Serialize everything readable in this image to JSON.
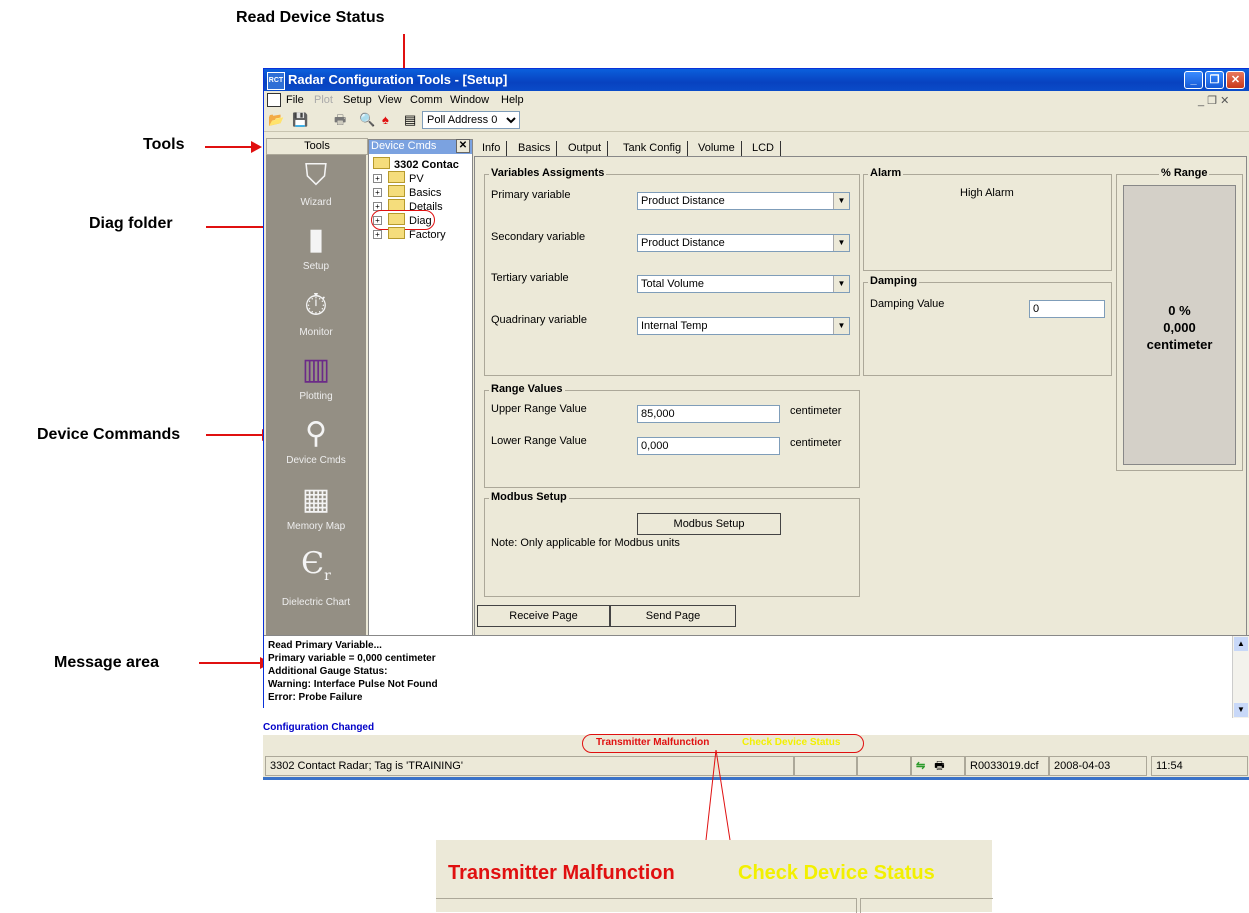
{
  "callouts": {
    "read_status": "Read Device Status",
    "tools": "Tools",
    "diag": "Diag folder",
    "device_commands": "Device Commands",
    "message_area": "Message area"
  },
  "window": {
    "title": "Radar Configuration Tools - [Setup]",
    "app_icon": "RCT"
  },
  "menu": [
    "File",
    "Plot",
    "Setup",
    "View",
    "Comm",
    "Window",
    "Help"
  ],
  "toolbar": {
    "poll_address": "Poll Address 0"
  },
  "tools": {
    "header": "Tools",
    "items": [
      {
        "label": "Wizard",
        "icon": "wizard-icon"
      },
      {
        "label": "Setup",
        "icon": "setup-icon"
      },
      {
        "label": "Monitor",
        "icon": "monitor-icon"
      },
      {
        "label": "Plotting",
        "icon": "plotting-icon"
      },
      {
        "label": "Device Cmds",
        "icon": "device-cmds-icon"
      },
      {
        "label": "Memory Map",
        "icon": "memory-map-icon"
      },
      {
        "label": "Dielectric Chart",
        "icon": "dielectric-chart-icon"
      }
    ]
  },
  "tree": {
    "header": "Device Cmds",
    "root": "3302 Contac",
    "items": [
      "PV",
      "Basics",
      "Details",
      "Diag",
      "Factory"
    ]
  },
  "tabs": [
    "Info",
    "Basics",
    "Output",
    "Tank Config",
    "Volume",
    "LCD"
  ],
  "variables": {
    "title": "Variables Assigments",
    "primary_label": "Primary variable",
    "primary_value": "Product Distance",
    "secondary_label": "Secondary variable",
    "secondary_value": "Product Distance",
    "tertiary_label": "Tertiary variable",
    "tertiary_value": "Total Volume",
    "quadrinary_label": "Quadrinary variable",
    "quadrinary_value": "Internal Temp"
  },
  "alarm": {
    "title": "Alarm",
    "value": "High Alarm"
  },
  "damping": {
    "title": "Damping",
    "label": "Damping Value",
    "value": "0"
  },
  "range_pct": {
    "title": "% Range",
    "percent": "0 %",
    "value": "0,000",
    "unit": "centimeter"
  },
  "range_values": {
    "title": "Range Values",
    "upper_label": "Upper Range Value",
    "upper_value": "85,000",
    "upper_unit": "centimeter",
    "lower_label": "Lower Range Value",
    "lower_value": "0,000",
    "lower_unit": "centimeter"
  },
  "modbus": {
    "title": "Modbus Setup",
    "button": "Modbus Setup",
    "note": "Note: Only applicable for Modbus units"
  },
  "buttons": {
    "receive": "Receive Page",
    "send": "Send Page"
  },
  "messages": [
    "Read Primary Variable...",
    "Primary variable = 0,000 centimeter",
    "Additional Gauge Status:",
    "Warning: Interface Pulse Not Found",
    "Error: Probe Failure"
  ],
  "config_changed": "Configuration Changed",
  "status": {
    "malfunction": "Transmitter Malfunction",
    "check": "Check Device Status",
    "device": "3302 Contact Radar;  Tag is 'TRAINING'",
    "file": "R0033019.dcf",
    "date": "2008-04-03",
    "time": "11:54"
  },
  "colors": {
    "malfunction": "#e01010",
    "check": "#f2f000",
    "link_blue": "#0000c8"
  }
}
